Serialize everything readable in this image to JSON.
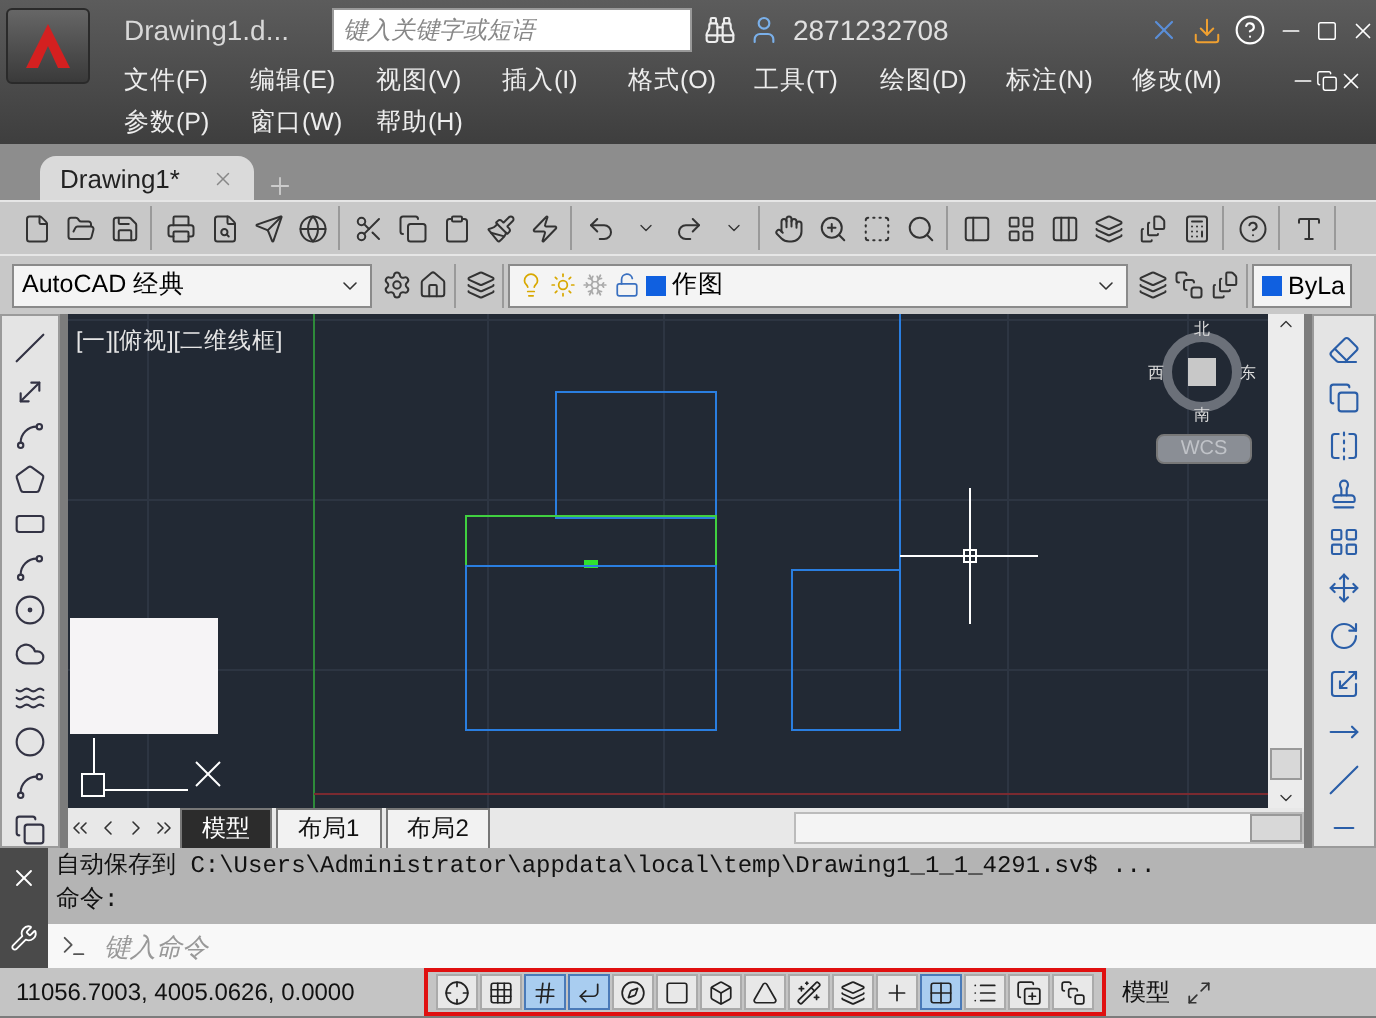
{
  "title_bar": {
    "document": "Drawing1.d...",
    "search": {
      "placeholder": "键入关键字或短语"
    },
    "user": "2871232708"
  },
  "menu_rows": [
    [
      "文件(F)",
      "编辑(E)",
      "视图(V)",
      "插入(I)",
      "格式(O)",
      "工具(T)",
      "绘图(D)",
      "标注(N)",
      "修改(M)"
    ],
    [
      "参数(P)",
      "窗口(W)",
      "帮助(H)"
    ]
  ],
  "document_tabs": [
    {
      "label": "Drawing1*",
      "selected": true
    }
  ],
  "workspace": "AutoCAD 经典",
  "layer": "作图",
  "color_control": "ByLa",
  "viewport": {
    "label": "[一][俯视][二维线框]",
    "compass": {
      "north": "北",
      "east": "东",
      "south": "南",
      "west": "西"
    },
    "ucs": "WCS"
  },
  "layout_tabs": [
    {
      "label": "模型",
      "selected": true
    },
    {
      "label": "布局1",
      "selected": false
    },
    {
      "label": "布局2",
      "selected": false
    }
  ],
  "command": {
    "history": [
      "自动保存到 C:\\Users\\Administrator\\appdata\\local\\temp\\Drawing1_1_1_4291.sv$ ...",
      "命令:"
    ],
    "placeholder": "键入命令"
  },
  "status_bar": {
    "coordinates": "11056.7003, 4005.0626, 0.0000",
    "space": "模型",
    "toggles": [
      {
        "selected": false
      },
      {
        "selected": false
      },
      {
        "selected": true
      },
      {
        "selected": true
      },
      {
        "selected": false
      },
      {
        "selected": false
      },
      {
        "selected": false
      },
      {
        "selected": false
      },
      {
        "selected": false
      },
      {
        "selected": false
      },
      {
        "selected": false
      },
      {
        "selected": true
      },
      {
        "selected": false
      },
      {
        "selected": false
      },
      {
        "selected": false
      }
    ]
  }
}
